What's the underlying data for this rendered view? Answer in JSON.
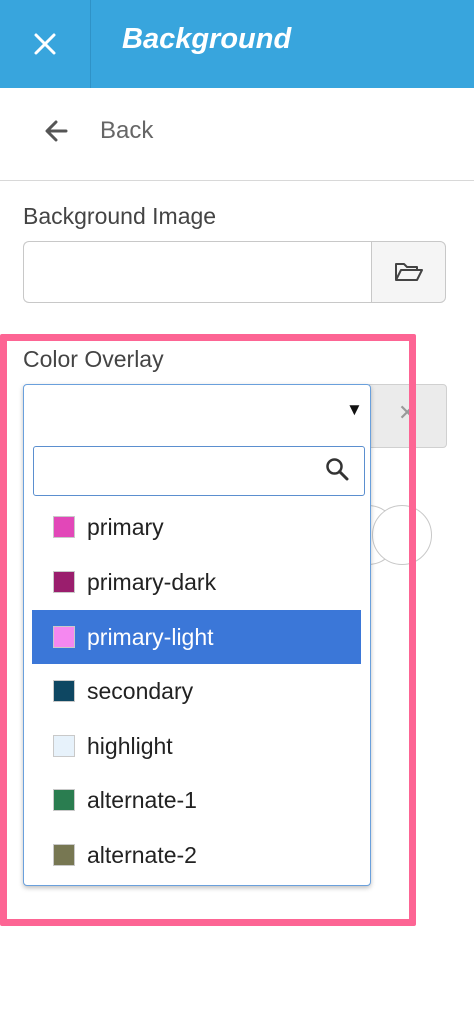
{
  "header": {
    "title": "Background"
  },
  "nav": {
    "back_label": "Back"
  },
  "background_image": {
    "label": "Background Image",
    "value": ""
  },
  "color_overlay": {
    "label": "Color Overlay",
    "selected_value": "",
    "search_value": "",
    "options": [
      {
        "label": "primary",
        "color": "#e247b8"
      },
      {
        "label": "primary-dark",
        "color": "#9a1e6d"
      },
      {
        "label": "primary-light",
        "color": "#f588f0"
      },
      {
        "label": "secondary",
        "color": "#0e4762"
      },
      {
        "label": "highlight",
        "color": "#e7f2fb"
      },
      {
        "label": "alternate-1",
        "color": "#2a7d50"
      },
      {
        "label": "alternate-2",
        "color": "#777752"
      }
    ],
    "highlighted_option": "primary-light"
  },
  "colors": {
    "header": "#38a5dd",
    "highlight_frame": "#fd6594",
    "selection": "#3b77d8"
  }
}
